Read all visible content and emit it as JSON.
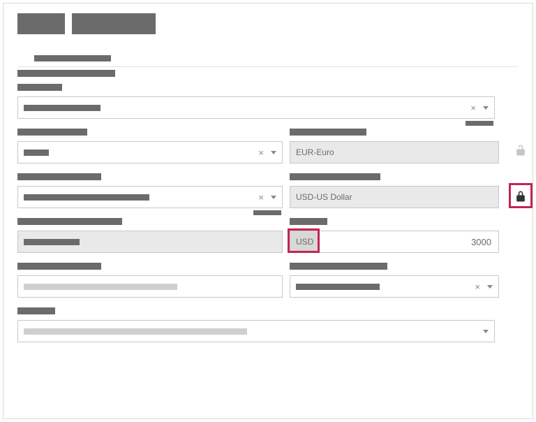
{
  "fields": {
    "origin_currency": "EUR-Euro",
    "destination_currency": "USD-US Dollar",
    "amount_prefix": "USD",
    "amount_value": "3000"
  }
}
